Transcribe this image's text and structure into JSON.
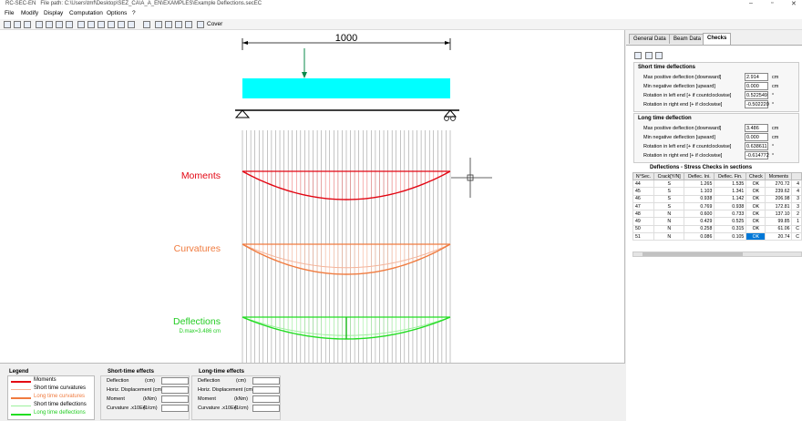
{
  "window": {
    "app_title": "RC-SEC-EN",
    "file_path": "File path:  C:\\Users\\tmf\\Desktop\\SEZ_CA\\A_A_EN\\EXAMPLES\\Example Deflections.secEC"
  },
  "menu": [
    "File",
    "Modify",
    "Display",
    "Computation",
    "Options",
    "?"
  ],
  "toolbar": {
    "cover_label": "Cover"
  },
  "drawing": {
    "span_label": "1000",
    "moments_label": "Moments",
    "curvatures_label": "Curvatures",
    "deflections_label": "Deflections",
    "dmax_label": "D.max=3.486 cm",
    "colors": {
      "moments": "#e30613",
      "curvatures": "#f07b3f",
      "deflections": "#22dd22",
      "beam": "#00ffff"
    }
  },
  "legend": {
    "title": "Legend",
    "items": [
      {
        "label": "Moments",
        "color": "#e30613"
      },
      {
        "label": "Short time curvatures",
        "color": "#f4b49a"
      },
      {
        "label": "Long time curvatures",
        "color": "#f07b3f"
      },
      {
        "label": "Short time deflections",
        "color": "#9cf09c"
      },
      {
        "label": "Long time deflections",
        "color": "#22dd22"
      }
    ]
  },
  "short_effects": {
    "title": "Short-time effects",
    "rows": [
      {
        "label": "Deflection",
        "unit": "(cm)"
      },
      {
        "label": "Horiz. Displacement (cm)",
        "unit": ""
      },
      {
        "label": "Moment",
        "unit": "(kNm)"
      },
      {
        "label": "Curvature .x10E4",
        "unit": "(1/cm)"
      }
    ]
  },
  "long_effects": {
    "title": "Long-time effects",
    "rows": [
      {
        "label": "Deflection",
        "unit": "(cm)"
      },
      {
        "label": "Horiz. Displacement (cm)",
        "unit": ""
      },
      {
        "label": "Moment",
        "unit": "(kNm)"
      },
      {
        "label": "Curvature .x10E4",
        "unit": "(1/cm)"
      }
    ]
  },
  "tabs": [
    "General Data",
    "Beam Data",
    "Checks"
  ],
  "short_time": {
    "title": "Short time deflections",
    "rows": [
      {
        "label": "Max positive deflection  [downward]",
        "value": "2.914",
        "unit": "cm"
      },
      {
        "label": "Min negative deflection  [upward]",
        "value": "0.000",
        "unit": "cm"
      },
      {
        "label": "Rotation in left end    [+ if countclockwise]",
        "value": "0.522549",
        "unit": "°"
      },
      {
        "label": "Rotation in right end    [+ if clockwise]",
        "value": "-0.502220",
        "unit": "°"
      }
    ]
  },
  "long_time": {
    "title": "Long time deflection",
    "rows": [
      {
        "label": "Max positive deflection [downward]",
        "value": "3.486",
        "unit": "cm"
      },
      {
        "label": "Min negative deflection [upward]",
        "value": "0.000",
        "unit": "cm"
      },
      {
        "label": "Rotation in left end   [+ if countclockwise]",
        "value": "0.638611",
        "unit": "°"
      },
      {
        "label": "Rotation in right end    [+ if clockwise]",
        "value": "-0.614772",
        "unit": "°"
      }
    ]
  },
  "checks_table": {
    "title": "Deflections - Stress Checks  in sections",
    "headers": [
      "N°Sec.",
      "Crack[Y/N]",
      "Deflec. Ini.",
      "Deflec. Fin.",
      "Check",
      "Moments",
      ""
    ],
    "rows": [
      [
        "44",
        "S",
        "1.265",
        "1.535",
        "OK",
        "270.72",
        "4"
      ],
      [
        "45",
        "S",
        "1.103",
        "1.341",
        "OK",
        "239.62",
        "4"
      ],
      [
        "46",
        "S",
        "0.938",
        "1.142",
        "OK",
        "206.98",
        "3"
      ],
      [
        "47",
        "S",
        "0.769",
        "0.938",
        "OK",
        "172.81",
        "3"
      ],
      [
        "48",
        "N",
        "0.600",
        "0.733",
        "OK",
        "137.10",
        "2"
      ],
      [
        "49",
        "N",
        "0.429",
        "0.525",
        "OK",
        "99.85",
        "1"
      ],
      [
        "50",
        "N",
        "0.258",
        "0.315",
        "OK",
        "61.06",
        "C"
      ],
      [
        "51",
        "N",
        "0.086",
        "0.105",
        "OK",
        "20.74",
        "C"
      ]
    ]
  }
}
